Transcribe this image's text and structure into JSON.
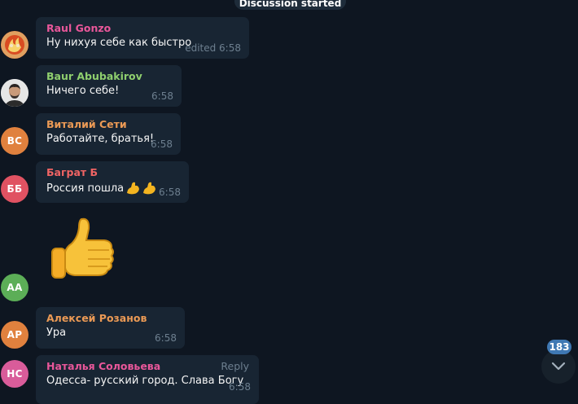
{
  "service_message": "Discussion started",
  "colors": {
    "background": "#0e1621",
    "bubble": "#182533",
    "name_pink": "#e9579a",
    "name_green": "#8fcf6e",
    "name_orange": "#eb9a55",
    "name_red": "#f06464",
    "meta": "#6d7f8f",
    "badge": "#3f78b3"
  },
  "messages": [
    {
      "name": "Raul Gonzo",
      "text": "Ну нихуя себе как быстро",
      "time": "edited 6:58",
      "avatar": "orange-flame-avatar"
    },
    {
      "name": "Baur Abubakirov",
      "text": "Ничего себе!",
      "time": "6:58",
      "avatar": "photo-avatar"
    },
    {
      "name": "Виталий Сети",
      "text": "Работайте, братья!",
      "time": "6:58",
      "avatar_initials": "ВС"
    },
    {
      "name": "Баграт Б",
      "text": "Россия пошла",
      "time": "6:58",
      "avatar_initials": "ББ"
    },
    {
      "sticker": "thumbs-up",
      "avatar_initials": "АА"
    },
    {
      "name": "Алексей Розанов",
      "text": "Ура",
      "time": "6:58",
      "avatar_initials": "АР"
    },
    {
      "name": "Наталья Соловьева",
      "text": "Одесса- русский город. Слава Богу",
      "time": "6:58",
      "reply_label": "Reply",
      "avatar_initials": "НС"
    }
  ],
  "unread_count": "183"
}
